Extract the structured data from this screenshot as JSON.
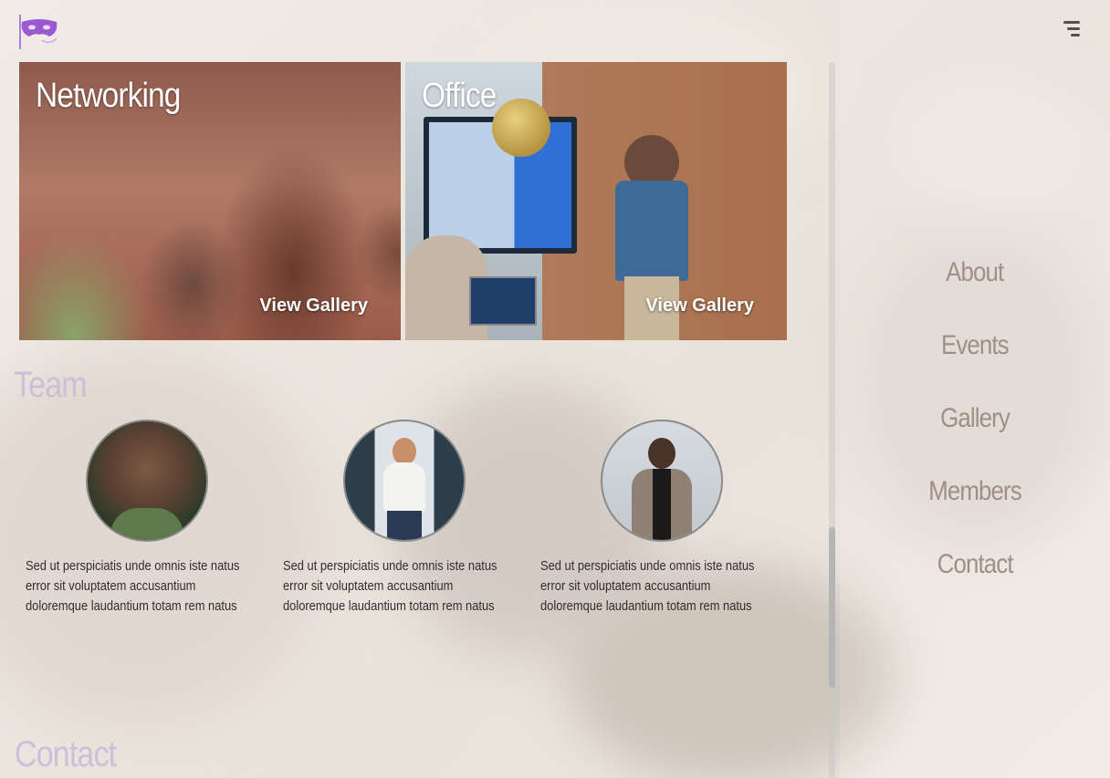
{
  "header": {
    "logo_icon": "party-mask-icon",
    "menu_icon": "hamburger-menu-icon"
  },
  "gallery": [
    {
      "title": "Networking",
      "cta": "View Gallery"
    },
    {
      "title": "Office",
      "cta": "View Gallery"
    }
  ],
  "team": {
    "heading": "Team",
    "members": [
      {
        "bio": "Sed ut perspiciatis unde omnis iste natus error sit voluptatem accusantium doloremque laudantium totam rem natus"
      },
      {
        "bio": "Sed ut perspiciatis unde omnis iste natus error sit voluptatem accusantium doloremque laudantium totam rem natus"
      },
      {
        "bio": "Sed ut perspiciatis unde omnis iste natus error sit voluptatem accusantium doloremque laudantium totam rem natus"
      }
    ]
  },
  "contact": {
    "heading": "Contact"
  },
  "side_nav": {
    "items": [
      {
        "label": "About"
      },
      {
        "label": "Events"
      },
      {
        "label": "Gallery"
      },
      {
        "label": "Members"
      },
      {
        "label": "Contact"
      }
    ]
  },
  "colors": {
    "accent": "#cbbfd9",
    "nav_text": "#9f8f85",
    "logo": "#9b59d0"
  }
}
